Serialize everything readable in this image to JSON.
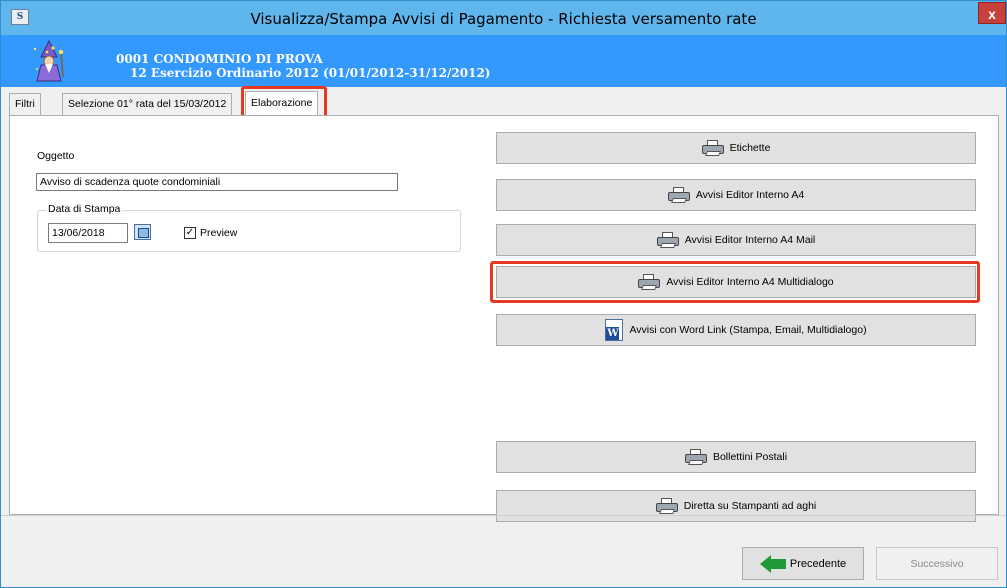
{
  "window": {
    "title": "Visualizza/Stampa Avvisi di Pagamento - Richiesta versamento rate",
    "close_label": "x"
  },
  "header": {
    "line1": "0001  CONDOMINIO DI PROVA",
    "line2": "12  Esercizio Ordinario 2012 (01/01/2012-31/12/2012)"
  },
  "tabs": [
    {
      "label": "Filtri"
    },
    {
      "label": "Selezione 01° rata del 15/03/2012"
    },
    {
      "label": "Elaborazione"
    }
  ],
  "form": {
    "oggetto_label": "Oggetto",
    "oggetto_value": "Avviso di scadenza quote condominiali",
    "data_stampa_label": "Data di Stampa",
    "data_stampa_value": "13/06/2018",
    "preview_label": "Preview",
    "preview_checked": true
  },
  "actions": [
    {
      "label": "Etichette",
      "icon": "printer-icon"
    },
    {
      "label": "Avvisi Editor Interno A4",
      "icon": "printer-icon"
    },
    {
      "label": "Avvisi Editor Interno A4 Mail",
      "icon": "printer-icon"
    },
    {
      "label": "Avvisi Editor Interno A4 Multidialogo",
      "icon": "printer-icon",
      "highlighted": true
    },
    {
      "label": "Avvisi con Word Link (Stampa, Email, Multidialogo)",
      "icon": "word-icon"
    },
    {
      "label": "Bollettini Postali",
      "icon": "printer-icon"
    },
    {
      "label": "Diretta su Stampanti ad aghi",
      "icon": "printer-icon"
    }
  ],
  "footer": {
    "prev_label": "Precedente",
    "next_label": "Successivo"
  },
  "colors": {
    "titlebar": "#5eb6ec",
    "header": "#3399ff",
    "highlight": "#e63a20"
  }
}
